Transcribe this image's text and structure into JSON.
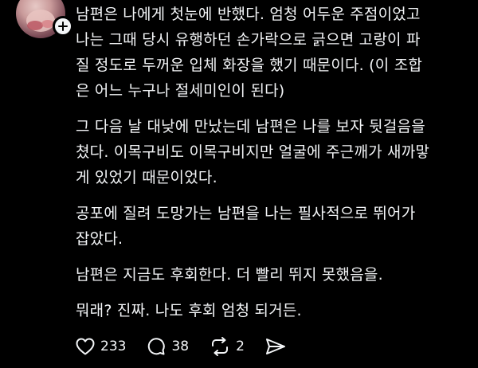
{
  "post": {
    "paragraphs": [
      {
        "lines": [
          "남편은 나에게 첫눈에 반했다.  엄청 어두운 주점이었고",
          "나는 그때 당시 유행하던 손가락으로 긁으면 고랑이 파",
          "질 정도로 두꺼운 입체 화장을 했기 때문이다. (이 조합",
          "은 어느 누구나 절세미인이 된다)"
        ]
      },
      {
        "lines": [
          "그 다음 날 대낮에 만났는데 남편은 나를 보자 뒷걸음을",
          "쳤다. 이목구비도 이목구비지만 얼굴에 주근깨가 새까맣",
          "게 있었기 때문이었다."
        ]
      },
      {
        "lines": [
          "공포에 질려 도망가는 남편을 나는 필사적으로 뛰어가",
          "잡았다."
        ]
      },
      {
        "lines": [
          "남편은 지금도 후회한다.  더 빨리 뛰지 못했음을."
        ]
      },
      {
        "lines": [
          "뭐래? 진짜. 나도 후회 엄청 되거든."
        ]
      }
    ]
  },
  "actions": {
    "likes": "233",
    "comments": "38",
    "reposts": "2"
  },
  "icons": {
    "like": "heart-icon",
    "comment": "comment-icon",
    "repost": "repost-icon",
    "share": "send-icon",
    "follow": "plus-icon"
  },
  "colors": {
    "background": "#000000",
    "text": "#f3f5f7"
  }
}
